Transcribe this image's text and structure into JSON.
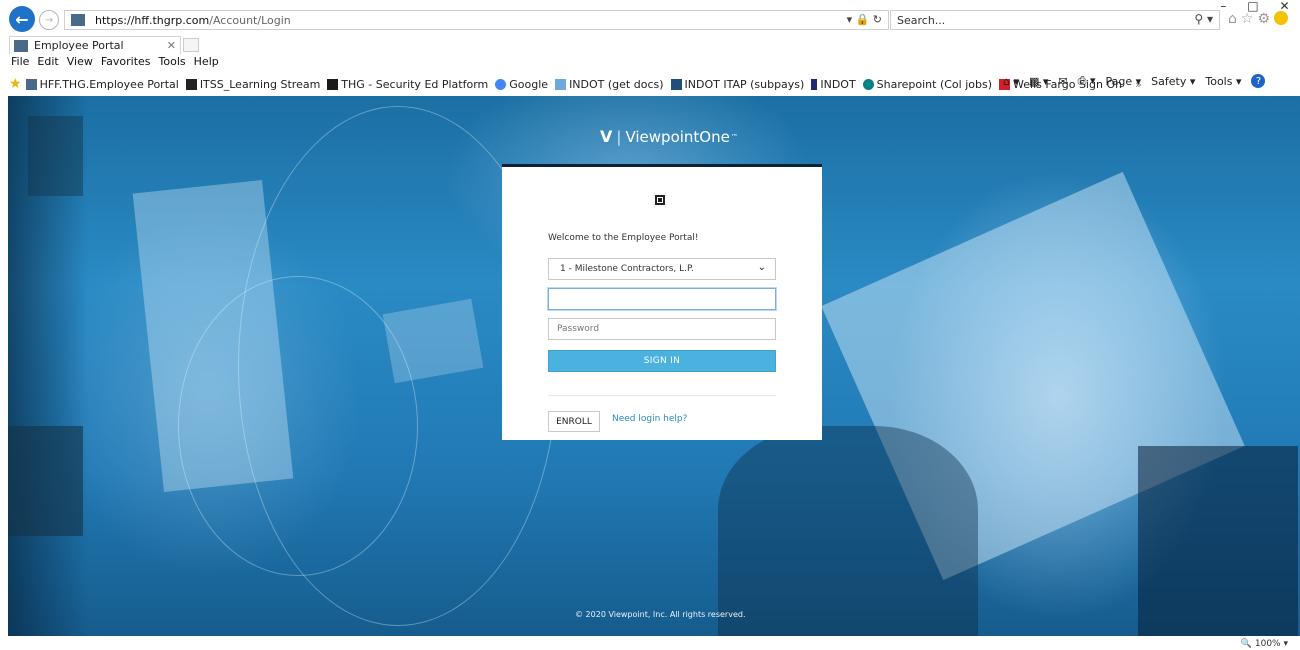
{
  "window": {
    "minimize": "–",
    "restore": "□",
    "close": "✕"
  },
  "address_bar": {
    "url_main": "https://hff.thgrp.com",
    "url_path": "/Account/Login",
    "tools": "▾ 🔒 ↻"
  },
  "search": {
    "placeholder": "Search...",
    "icon": "search-icon"
  },
  "tabs": [
    {
      "title": "Employee Portal"
    }
  ],
  "menu": [
    "File",
    "Edit",
    "View",
    "Favorites",
    "Tools",
    "Help"
  ],
  "favorites": [
    {
      "label": "HFF.THG.Employee Portal",
      "color": "#4a6a8a"
    },
    {
      "label": "ITSS_Learning Stream",
      "color": "#222222"
    },
    {
      "label": "THG - Security Ed Platform",
      "color": "#1a1a1a"
    },
    {
      "label": "Google",
      "color": "#4285f4"
    },
    {
      "label": "INDOT (get docs)",
      "color": "#6fa8dc"
    },
    {
      "label": "INDOT ITAP (subpays)",
      "color": "#1f4e79"
    },
    {
      "label": "INDOT",
      "color": "#1e2a78"
    },
    {
      "label": "Sharepoint (Col jobs)",
      "color": "#038387"
    },
    {
      "label": "Wells Fargo Sign On",
      "color": "#d71e28"
    }
  ],
  "favorites_overflow": "»",
  "command_bar": {
    "page": "Page ▾",
    "safety": "Safety ▾",
    "tools": "Tools ▾"
  },
  "brand": {
    "mark": "V",
    "name": "ViewpointOne",
    "trademark": "™"
  },
  "login": {
    "welcome": "Welcome to the Employee Portal!",
    "company_selected": "1 - Milestone Contractors, L.P.",
    "username_value": "",
    "password_placeholder": "Password",
    "sign_in_label": "SIGN IN",
    "enroll_label": "ENROLL",
    "help_link": "Need login help?"
  },
  "footer": {
    "copyright": "© 2020 Viewpoint, Inc. All rights reserved."
  },
  "status_bar": {
    "zoom": "100%"
  },
  "colors": {
    "accent": "#4bb1de",
    "link": "#2a8ac4",
    "background_blue": "#2179b4"
  }
}
